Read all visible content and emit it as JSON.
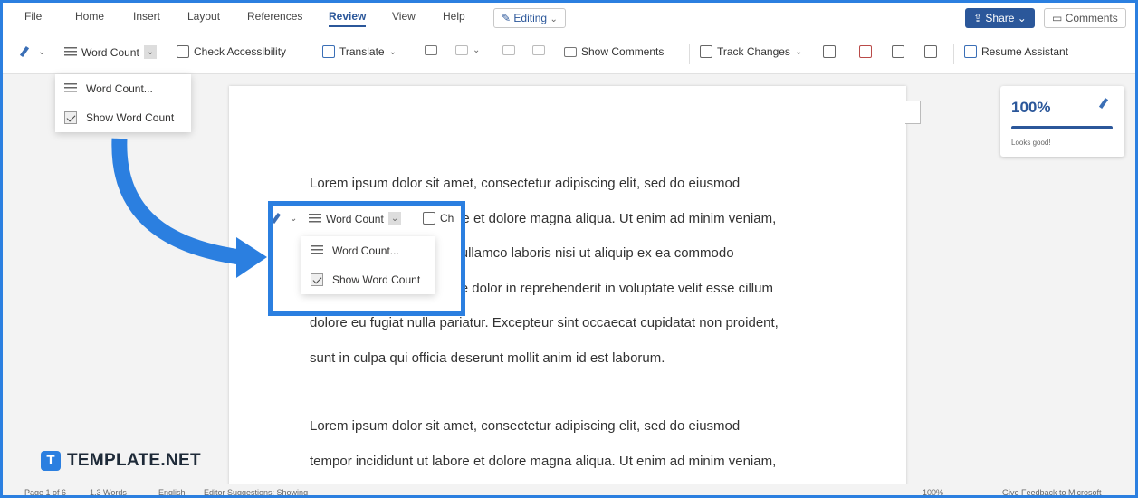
{
  "tabs": [
    "File",
    "Home",
    "Insert",
    "Layout",
    "References",
    "Review",
    "View",
    "Help"
  ],
  "active_tab": "Review",
  "editing_label": "Editing",
  "share_label": "Share",
  "comments_label": "Comments",
  "ribbon": {
    "word_count": "Word Count",
    "check_accessibility": "Check Accessibility",
    "translate": "Translate",
    "show_comments": "Show Comments",
    "track_changes": "Track Changes",
    "resume_assistant": "Resume Assistant"
  },
  "word_count_menu": {
    "item1": "Word Count...",
    "item2": "Show Word Count"
  },
  "callout": {
    "word_count": "Word Count",
    "check_fragment": "Ch",
    "item1": "Word Count...",
    "item2": "Show Word Count"
  },
  "document": {
    "paragraph1": [
      "Lorem ipsum dolor sit amet, consectetur adipiscing elit, sed do eiusmod",
      "tempor incididunt ut labore et dolore magna aliqua. Ut enim ad minim veniam,",
      "quis nostrud exercitation ullamco laboris nisi ut aliquip ex ea commodo",
      "consequat. Duis aute irure dolor in reprehenderit in voluptate velit esse cillum",
      "dolore eu fugiat nulla pariatur. Excepteur sint occaecat cupidatat non proident,",
      "sunt in culpa qui officia deserunt mollit anim id est laborum."
    ],
    "paragraph2": [
      "Lorem ipsum dolor sit amet, consectetur adipiscing elit, sed do eiusmod",
      "tempor incididunt ut labore et dolore magna aliqua. Ut enim ad minim veniam,"
    ]
  },
  "editor": {
    "score": "100%",
    "note": "Looks good!",
    "progress": 1.0
  },
  "status_bar": {
    "page": "Page 1 of 6",
    "words": "1,3 Words",
    "language": "English",
    "editor_status": "Editor Suggestions: Showing",
    "zoom": "100%",
    "feedback": "Give Feedback to Microsoft"
  },
  "watermark": "TEMPLATE.NET",
  "colors": {
    "accent": "#2b7fe0",
    "brand": "#2b579a"
  }
}
